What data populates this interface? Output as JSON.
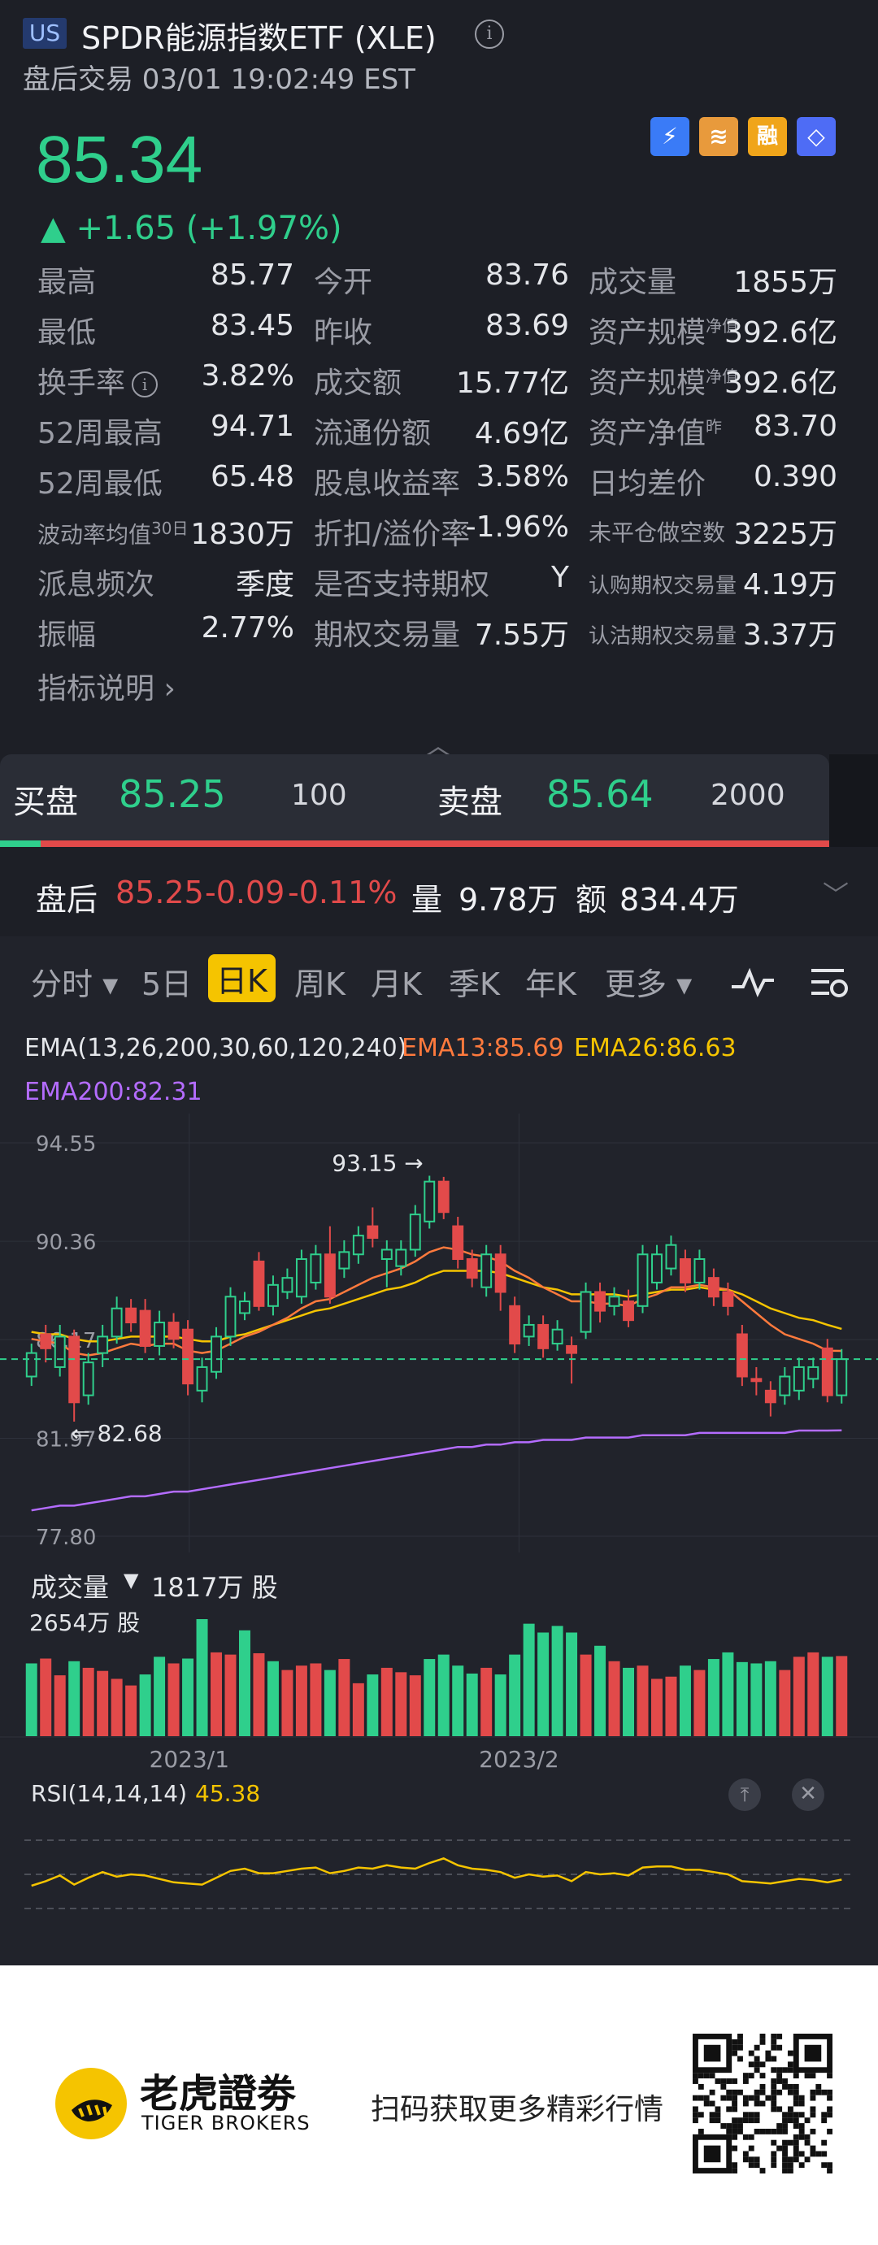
{
  "header": {
    "market_badge": "US",
    "title": "SPDR能源指数ETF (XLE)",
    "session": "盘后交易 03/01 19:02:49 EST"
  },
  "quote": {
    "price": "85.34",
    "change": "▲ +1.65 (+1.97%)",
    "badges": [
      "⚡",
      "≋",
      "融",
      "◇"
    ]
  },
  "stats": {
    "high_label": "最高",
    "high": "85.77",
    "open_label": "今开",
    "open": "83.76",
    "volume_label": "成交量",
    "volume": "1855万",
    "low_label": "最低",
    "low": "83.45",
    "prev_close_label": "昨收",
    "prev_close": "83.69",
    "aum_nav_label": "资产规模",
    "aum_nav_sup": "净值",
    "aum_nav": "392.6亿",
    "turnover_label": "换手率",
    "turnover": "3.82%",
    "amount_label": "成交额",
    "amount": "15.77亿",
    "aum_label": "资产规模",
    "aum_sup": "净值",
    "aum": "392.6亿",
    "w52_high_label": "52周最高",
    "w52_high": "94.71",
    "float_label": "流通份额",
    "float": "4.69亿",
    "nav_label": "资产净值",
    "nav_sup": "昨",
    "nav": "83.70",
    "w52_low_label": "52周最低",
    "w52_low": "65.48",
    "dividend_yield_label": "股息收益率",
    "dividend_yield": "3.58%",
    "avg_spread_label": "日均差价",
    "avg_spread": "0.390",
    "volatility_label": "波动率均值",
    "volatility_sup": "30日",
    "volatility": "1830万",
    "premium_label": "折扣/溢价率",
    "premium": "-1.96%",
    "short_interest_label": "未平仓做空数",
    "short_interest": "3225万",
    "dividend_freq_label": "派息频次",
    "dividend_freq": "季度",
    "options_support_label": "是否支持期权",
    "options_support": "Y",
    "call_volume_label": "认购期权交易量",
    "call_volume": "4.19万",
    "amplitude_label": "振幅",
    "amplitude": "2.77%",
    "option_volume_label": "期权交易量",
    "option_volume": "7.55万",
    "put_volume_label": "认沽期权交易量",
    "put_volume": "3.37万",
    "metric_link": "指标说明  ›"
  },
  "bidask": {
    "bid_label": "买盘",
    "bid_price": "85.25",
    "bid_size": "100",
    "ask_label": "卖盘",
    "ask_price": "85.64",
    "ask_size": "2000"
  },
  "after_hours": {
    "label": "盘后",
    "price": "85.25",
    "change": "-0.09",
    "pct": "-0.11%",
    "vol_label": "量",
    "vol": "9.78万",
    "amt_label": "额",
    "amt": "834.4万"
  },
  "tabs": [
    "分时 ▾",
    "5日",
    "日K",
    "周K",
    "月K",
    "季K",
    "年K",
    "更多 ▾"
  ],
  "ema": {
    "title": "EMA(13,26,200,30,60,120,240)",
    "ema13": "EMA13:85.69",
    "ema26": "EMA26:86.63",
    "ema200": "EMA200:82.31"
  },
  "colors": {
    "up": "#e24a4a",
    "down": "#2fcf8c",
    "ema13": "#ff7a3d",
    "ema26": "#f5c400",
    "ema200": "#b46cff",
    "accent": "#f5c400"
  },
  "chart_data": [
    {
      "type": "candlestick",
      "title": "",
      "y_ticks": [
        "94.55",
        "90.36",
        "86.17",
        "81.97",
        "77.80"
      ],
      "ylim": [
        77.8,
        94.55
      ],
      "annotations": {
        "high": "93.15",
        "low": "82.68"
      },
      "x_ticks": [
        "2023/1",
        "2023/2"
      ],
      "last_close_line": 85.34,
      "candles": [
        {
          "o": 84.6,
          "c": 85.6,
          "h": 86.0,
          "l": 84.2
        },
        {
          "o": 86.4,
          "c": 85.8,
          "h": 86.8,
          "l": 85.2
        },
        {
          "o": 85.0,
          "c": 86.3,
          "h": 86.8,
          "l": 84.6
        },
        {
          "o": 86.3,
          "c": 83.5,
          "h": 86.6,
          "l": 82.68
        },
        {
          "o": 83.8,
          "c": 85.2,
          "h": 85.6,
          "l": 83.4
        },
        {
          "o": 85.6,
          "c": 86.3,
          "h": 86.8,
          "l": 85.0
        },
        {
          "o": 86.3,
          "c": 87.5,
          "h": 88.0,
          "l": 86.0
        },
        {
          "o": 87.5,
          "c": 86.9,
          "h": 87.9,
          "l": 86.5
        },
        {
          "o": 87.4,
          "c": 85.9,
          "h": 87.9,
          "l": 85.6
        },
        {
          "o": 85.9,
          "c": 86.9,
          "h": 87.4,
          "l": 85.5
        },
        {
          "o": 86.9,
          "c": 86.2,
          "h": 87.3,
          "l": 85.8
        },
        {
          "o": 86.6,
          "c": 84.3,
          "h": 87.0,
          "l": 83.8
        },
        {
          "o": 84.0,
          "c": 85.0,
          "h": 85.4,
          "l": 83.5
        },
        {
          "o": 84.8,
          "c": 86.3,
          "h": 86.7,
          "l": 84.5
        },
        {
          "o": 86.3,
          "c": 88.0,
          "h": 88.4,
          "l": 85.9
        },
        {
          "o": 87.3,
          "c": 87.8,
          "h": 88.2,
          "l": 87.0
        },
        {
          "o": 89.5,
          "c": 87.6,
          "h": 89.9,
          "l": 87.4
        },
        {
          "o": 87.6,
          "c": 88.5,
          "h": 88.9,
          "l": 87.2
        },
        {
          "o": 88.2,
          "c": 88.8,
          "h": 89.2,
          "l": 87.9
        },
        {
          "o": 88.0,
          "c": 89.6,
          "h": 90.0,
          "l": 87.7
        },
        {
          "o": 88.6,
          "c": 89.8,
          "h": 90.2,
          "l": 88.3
        },
        {
          "o": 89.8,
          "c": 88.0,
          "h": 91.0,
          "l": 87.7
        },
        {
          "o": 89.2,
          "c": 89.9,
          "h": 90.4,
          "l": 88.8
        },
        {
          "o": 89.8,
          "c": 90.6,
          "h": 91.0,
          "l": 89.4
        },
        {
          "o": 91.0,
          "c": 90.5,
          "h": 91.8,
          "l": 90.1
        },
        {
          "o": 89.6,
          "c": 90.0,
          "h": 90.4,
          "l": 88.4
        },
        {
          "o": 89.3,
          "c": 90.0,
          "h": 90.4,
          "l": 88.9
        },
        {
          "o": 90.0,
          "c": 91.5,
          "h": 91.9,
          "l": 89.7
        },
        {
          "o": 91.2,
          "c": 92.9,
          "h": 93.15,
          "l": 90.9
        },
        {
          "o": 92.9,
          "c": 91.6,
          "h": 93.1,
          "l": 91.3
        },
        {
          "o": 91.0,
          "c": 89.6,
          "h": 91.4,
          "l": 89.2
        },
        {
          "o": 89.6,
          "c": 88.8,
          "h": 90.0,
          "l": 88.4
        },
        {
          "o": 88.4,
          "c": 89.8,
          "h": 90.2,
          "l": 88.0
        },
        {
          "o": 89.8,
          "c": 88.2,
          "h": 90.2,
          "l": 87.4
        },
        {
          "o": 87.6,
          "c": 86.0,
          "h": 88.0,
          "l": 85.6
        },
        {
          "o": 86.3,
          "c": 86.8,
          "h": 87.2,
          "l": 85.9
        },
        {
          "o": 86.8,
          "c": 85.8,
          "h": 87.2,
          "l": 85.4
        },
        {
          "o": 86.0,
          "c": 86.6,
          "h": 87.0,
          "l": 85.7
        },
        {
          "o": 85.9,
          "c": 85.6,
          "h": 86.3,
          "l": 84.3
        },
        {
          "o": 86.5,
          "c": 88.2,
          "h": 88.6,
          "l": 86.2
        },
        {
          "o": 88.2,
          "c": 87.4,
          "h": 88.6,
          "l": 86.9
        },
        {
          "o": 87.6,
          "c": 88.0,
          "h": 88.4,
          "l": 87.2
        },
        {
          "o": 87.8,
          "c": 87.0,
          "h": 88.3,
          "l": 86.7
        },
        {
          "o": 87.6,
          "c": 89.8,
          "h": 90.2,
          "l": 87.3
        },
        {
          "o": 88.6,
          "c": 89.8,
          "h": 90.2,
          "l": 88.3
        },
        {
          "o": 89.2,
          "c": 90.2,
          "h": 90.6,
          "l": 88.9
        },
        {
          "o": 89.6,
          "c": 88.6,
          "h": 90.0,
          "l": 88.2
        },
        {
          "o": 88.6,
          "c": 89.6,
          "h": 90.0,
          "l": 88.3
        },
        {
          "o": 88.8,
          "c": 88.0,
          "h": 89.2,
          "l": 87.6
        },
        {
          "o": 88.2,
          "c": 87.6,
          "h": 88.6,
          "l": 87.2
        },
        {
          "o": 86.4,
          "c": 84.6,
          "h": 86.8,
          "l": 84.2
        },
        {
          "o": 84.5,
          "c": 84.4,
          "h": 85.0,
          "l": 83.8
        },
        {
          "o": 84.0,
          "c": 83.5,
          "h": 84.4,
          "l": 82.9
        },
        {
          "o": 83.8,
          "c": 84.6,
          "h": 85.0,
          "l": 83.4
        },
        {
          "o": 84.0,
          "c": 85.0,
          "h": 85.4,
          "l": 83.6
        },
        {
          "o": 84.5,
          "c": 85.0,
          "h": 85.4,
          "l": 84.1
        },
        {
          "o": 85.8,
          "c": 83.8,
          "h": 86.2,
          "l": 83.5
        },
        {
          "o": 83.8,
          "c": 85.34,
          "h": 85.77,
          "l": 83.45
        }
      ],
      "ema13": [
        86.2,
        86.1,
        86.0,
        85.6,
        85.5,
        85.6,
        85.8,
        86.0,
        85.9,
        86.0,
        86.0,
        85.7,
        85.6,
        85.7,
        86.0,
        86.3,
        86.5,
        86.8,
        87.1,
        87.5,
        87.8,
        87.9,
        88.2,
        88.5,
        88.8,
        89.0,
        89.2,
        89.5,
        89.9,
        90.1,
        90.0,
        89.8,
        89.7,
        89.5,
        89.1,
        88.8,
        88.4,
        88.1,
        87.8,
        87.8,
        87.7,
        87.7,
        87.6,
        87.9,
        88.1,
        88.4,
        88.4,
        88.5,
        88.4,
        88.3,
        87.8,
        87.3,
        86.8,
        86.4,
        86.2,
        86.0,
        85.7,
        85.69
      ],
      "ema26": [
        86.5,
        86.4,
        86.4,
        86.2,
        86.1,
        86.1,
        86.2,
        86.3,
        86.3,
        86.3,
        86.3,
        86.2,
        86.1,
        86.1,
        86.3,
        86.4,
        86.6,
        86.8,
        87.0,
        87.2,
        87.4,
        87.5,
        87.7,
        87.9,
        88.1,
        88.3,
        88.4,
        88.6,
        88.9,
        89.1,
        89.1,
        89.1,
        89.1,
        89.0,
        88.8,
        88.6,
        88.4,
        88.3,
        88.1,
        88.1,
        88.1,
        88.1,
        88.0,
        88.1,
        88.2,
        88.3,
        88.3,
        88.4,
        88.3,
        88.3,
        88.1,
        87.8,
        87.5,
        87.3,
        87.1,
        87.0,
        86.8,
        86.63
      ],
      "ema200": [
        78.9,
        79.0,
        79.1,
        79.1,
        79.2,
        79.3,
        79.4,
        79.5,
        79.5,
        79.6,
        79.7,
        79.7,
        79.8,
        79.9,
        80.0,
        80.1,
        80.2,
        80.3,
        80.4,
        80.5,
        80.6,
        80.7,
        80.8,
        80.9,
        81.0,
        81.1,
        81.2,
        81.3,
        81.4,
        81.5,
        81.6,
        81.6,
        81.7,
        81.7,
        81.8,
        81.8,
        81.9,
        81.9,
        81.9,
        82.0,
        82.0,
        82.0,
        82.0,
        82.1,
        82.1,
        82.1,
        82.1,
        82.2,
        82.2,
        82.2,
        82.2,
        82.2,
        82.2,
        82.2,
        82.3,
        82.3,
        82.3,
        82.31
      ]
    },
    {
      "type": "bar",
      "title": "成交量",
      "current_label": "1817万 股",
      "max_label": "2654万 股",
      "values": [
        1650,
        1760,
        1380,
        1700,
        1550,
        1480,
        1300,
        1150,
        1400,
        1800,
        1650,
        1760,
        2654,
        1900,
        1850,
        2400,
        1880,
        1700,
        1500,
        1600,
        1650,
        1500,
        1750,
        1200,
        1400,
        1550,
        1450,
        1380,
        1750,
        1850,
        1600,
        1420,
        1550,
        1400,
        1850,
        2550,
        2350,
        2500,
        2350,
        1850,
        2050,
        1700,
        1550,
        1600,
        1300,
        1350,
        1600,
        1500,
        1750,
        1900,
        1680,
        1650,
        1700,
        1500,
        1800,
        1900,
        1800,
        1817
      ],
      "up": [
        true,
        false,
        false,
        true,
        false,
        false,
        false,
        false,
        true,
        true,
        false,
        true,
        true,
        false,
        false,
        true,
        false,
        true,
        false,
        false,
        false,
        true,
        false,
        false,
        true,
        false,
        false,
        false,
        true,
        true,
        true,
        true,
        false,
        true,
        true,
        true,
        true,
        true,
        true,
        false,
        true,
        false,
        true,
        false,
        false,
        false,
        true,
        false,
        true,
        true,
        true,
        true,
        true,
        false,
        false,
        false,
        true,
        false
      ]
    },
    {
      "type": "line",
      "title": "RSI(14,14,14)",
      "current_label": "45.38",
      "ylim": [
        0,
        100
      ],
      "values": [
        40,
        44,
        49,
        41,
        47,
        52,
        48,
        50,
        49,
        46,
        43,
        42,
        41,
        47,
        53,
        55,
        51,
        51,
        53,
        55,
        56,
        51,
        53,
        56,
        55,
        58,
        56,
        55,
        60,
        64,
        58,
        55,
        54,
        52,
        47,
        50,
        48,
        49,
        44,
        52,
        50,
        51,
        49,
        56,
        57,
        57,
        54,
        54,
        52,
        50,
        44,
        43,
        42,
        44,
        46,
        45,
        43,
        45.38
      ]
    }
  ],
  "footer": {
    "brand_cn": "老虎證劵",
    "brand_en": "TIGER BROKERS",
    "slogan": "扫码获取更多精彩行情"
  }
}
